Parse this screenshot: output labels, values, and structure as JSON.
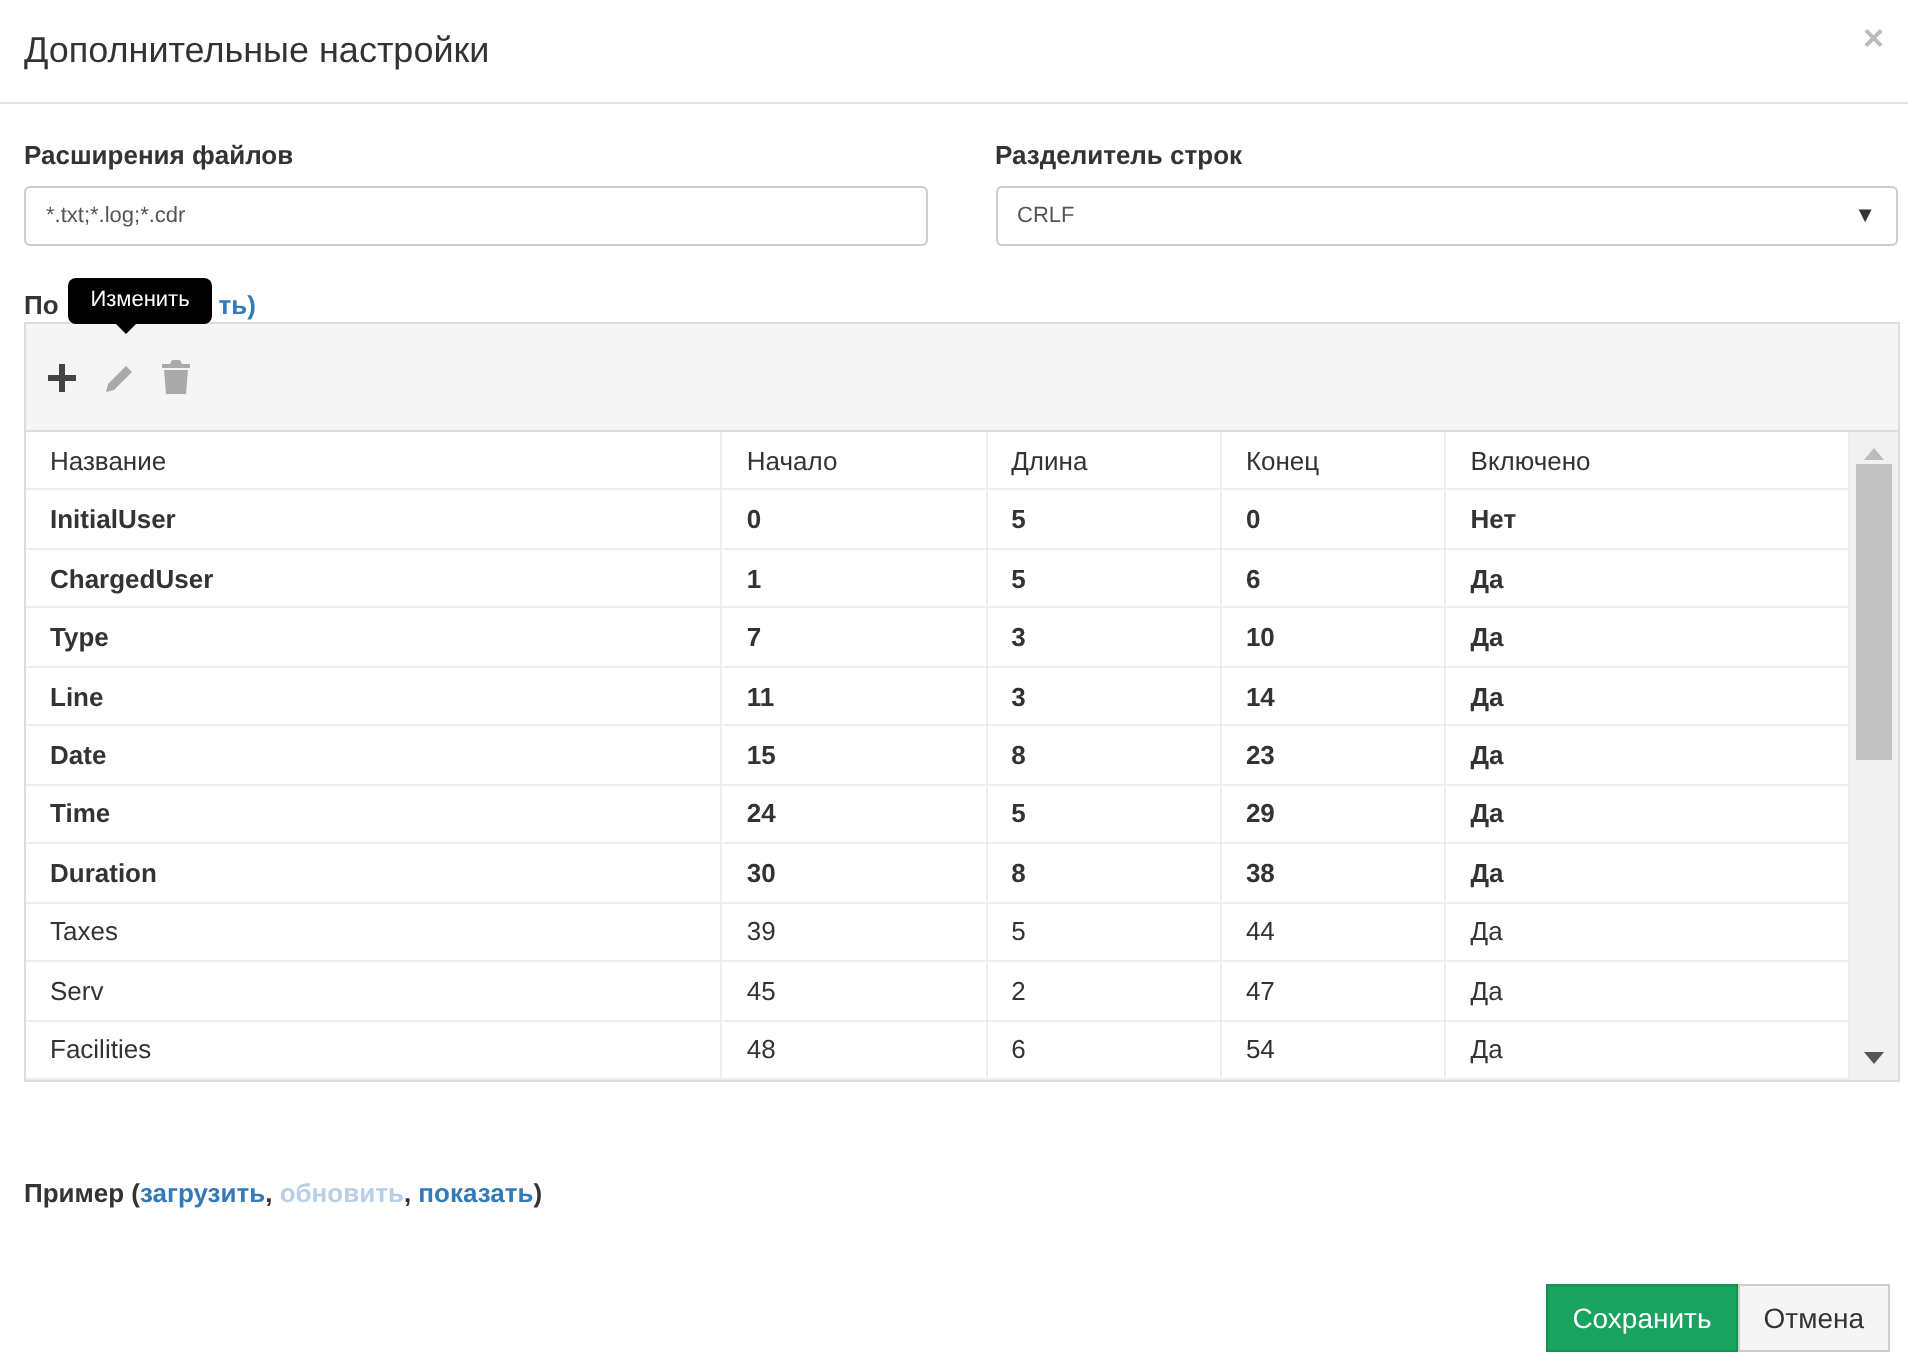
{
  "dialog": {
    "title": "Дополнительные настройки",
    "close": "×"
  },
  "extensions": {
    "label": "Расширения файлов",
    "value": "*.txt;*.log;*.cdr"
  },
  "separator": {
    "label": "Разделитель строк",
    "value": "CRLF",
    "caret": "▼"
  },
  "fields_label": {
    "start": "По",
    "end": "ть)"
  },
  "tooltip": "Изменить",
  "toolbar": [
    {
      "kind": "add",
      "disabled": false
    },
    {
      "kind": "edit",
      "disabled": true
    },
    {
      "kind": "delete",
      "disabled": true
    }
  ],
  "table": {
    "columns": [
      "Название",
      "Начало",
      "Длина",
      "Конец",
      "Включено"
    ],
    "rows": [
      {
        "cells": [
          "InitialUser",
          "0",
          "5",
          "0",
          "Нет"
        ],
        "bold": true
      },
      {
        "cells": [
          "ChargedUser",
          "1",
          "5",
          "6",
          "Да"
        ],
        "bold": true
      },
      {
        "cells": [
          "Type",
          "7",
          "3",
          "10",
          "Да"
        ],
        "bold": true
      },
      {
        "cells": [
          "Line",
          "11",
          "3",
          "14",
          "Да"
        ],
        "bold": true
      },
      {
        "cells": [
          "Date",
          "15",
          "8",
          "23",
          "Да"
        ],
        "bold": true
      },
      {
        "cells": [
          "Time",
          "24",
          "5",
          "29",
          "Да"
        ],
        "bold": true
      },
      {
        "cells": [
          "Duration",
          "30",
          "8",
          "38",
          "Да"
        ],
        "bold": true
      },
      {
        "cells": [
          "Taxes",
          "39",
          "5",
          "44",
          "Да"
        ],
        "bold": false
      },
      {
        "cells": [
          "Serv",
          "45",
          "2",
          "47",
          "Да"
        ],
        "bold": false
      },
      {
        "cells": [
          "Facilities",
          "48",
          "6",
          "54",
          "Да"
        ],
        "bold": false
      }
    ]
  },
  "example": {
    "label": "Пример (",
    "links": [
      {
        "text": "загрузить",
        "disabled": false
      },
      {
        "text": "обновить",
        "disabled": true
      },
      {
        "text": "показать",
        "disabled": false
      }
    ],
    "separator": ", ",
    "end": ")"
  },
  "buttons": [
    {
      "label": "Сохранить",
      "kind": "primary"
    },
    {
      "label": "Отмена",
      "kind": "default"
    }
  ]
}
